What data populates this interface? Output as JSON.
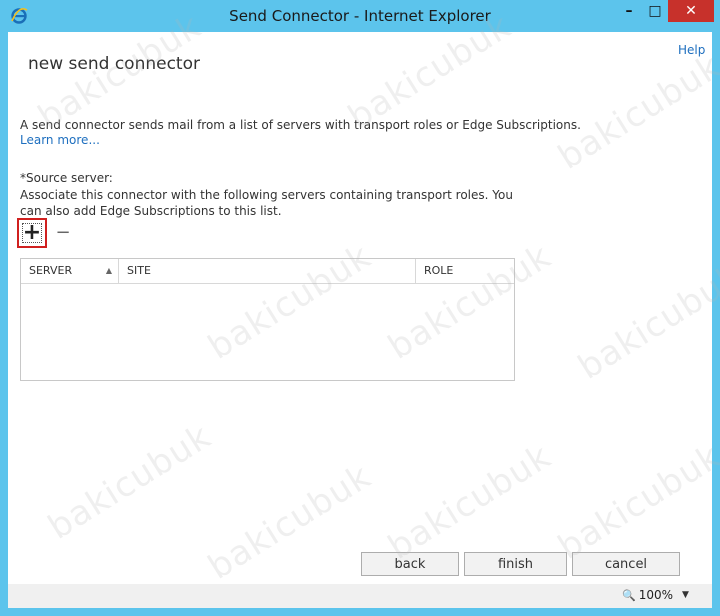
{
  "window": {
    "title": "Send Connector - Internet Explorer",
    "controls": {
      "minimize": "–",
      "maximize": "□",
      "close": "✕"
    }
  },
  "page": {
    "help": "Help",
    "title": "new send connector",
    "description": "A send connector sends mail from a list of servers with transport roles or Edge Subscriptions.",
    "learn_more": "Learn more...",
    "source_label": "*Source server:",
    "source_description": "Associate this connector with the following servers containing transport roles. You can also add Edge Subscriptions to this list."
  },
  "toolbar": {
    "add_symbol": "+",
    "remove_symbol": "−"
  },
  "grid": {
    "columns": [
      "SERVER",
      "SITE",
      "ROLE"
    ],
    "sort_indicator": "▲",
    "rows": []
  },
  "buttons": {
    "back": "back",
    "finish": "finish",
    "cancel": "cancel"
  },
  "status": {
    "zoom": "100%"
  },
  "watermark": "bakicubuk",
  "colors": {
    "titlebar": "#5cc4ec",
    "close": "#c7312b",
    "link": "#1e6fbf",
    "highlight": "#d0201f"
  }
}
